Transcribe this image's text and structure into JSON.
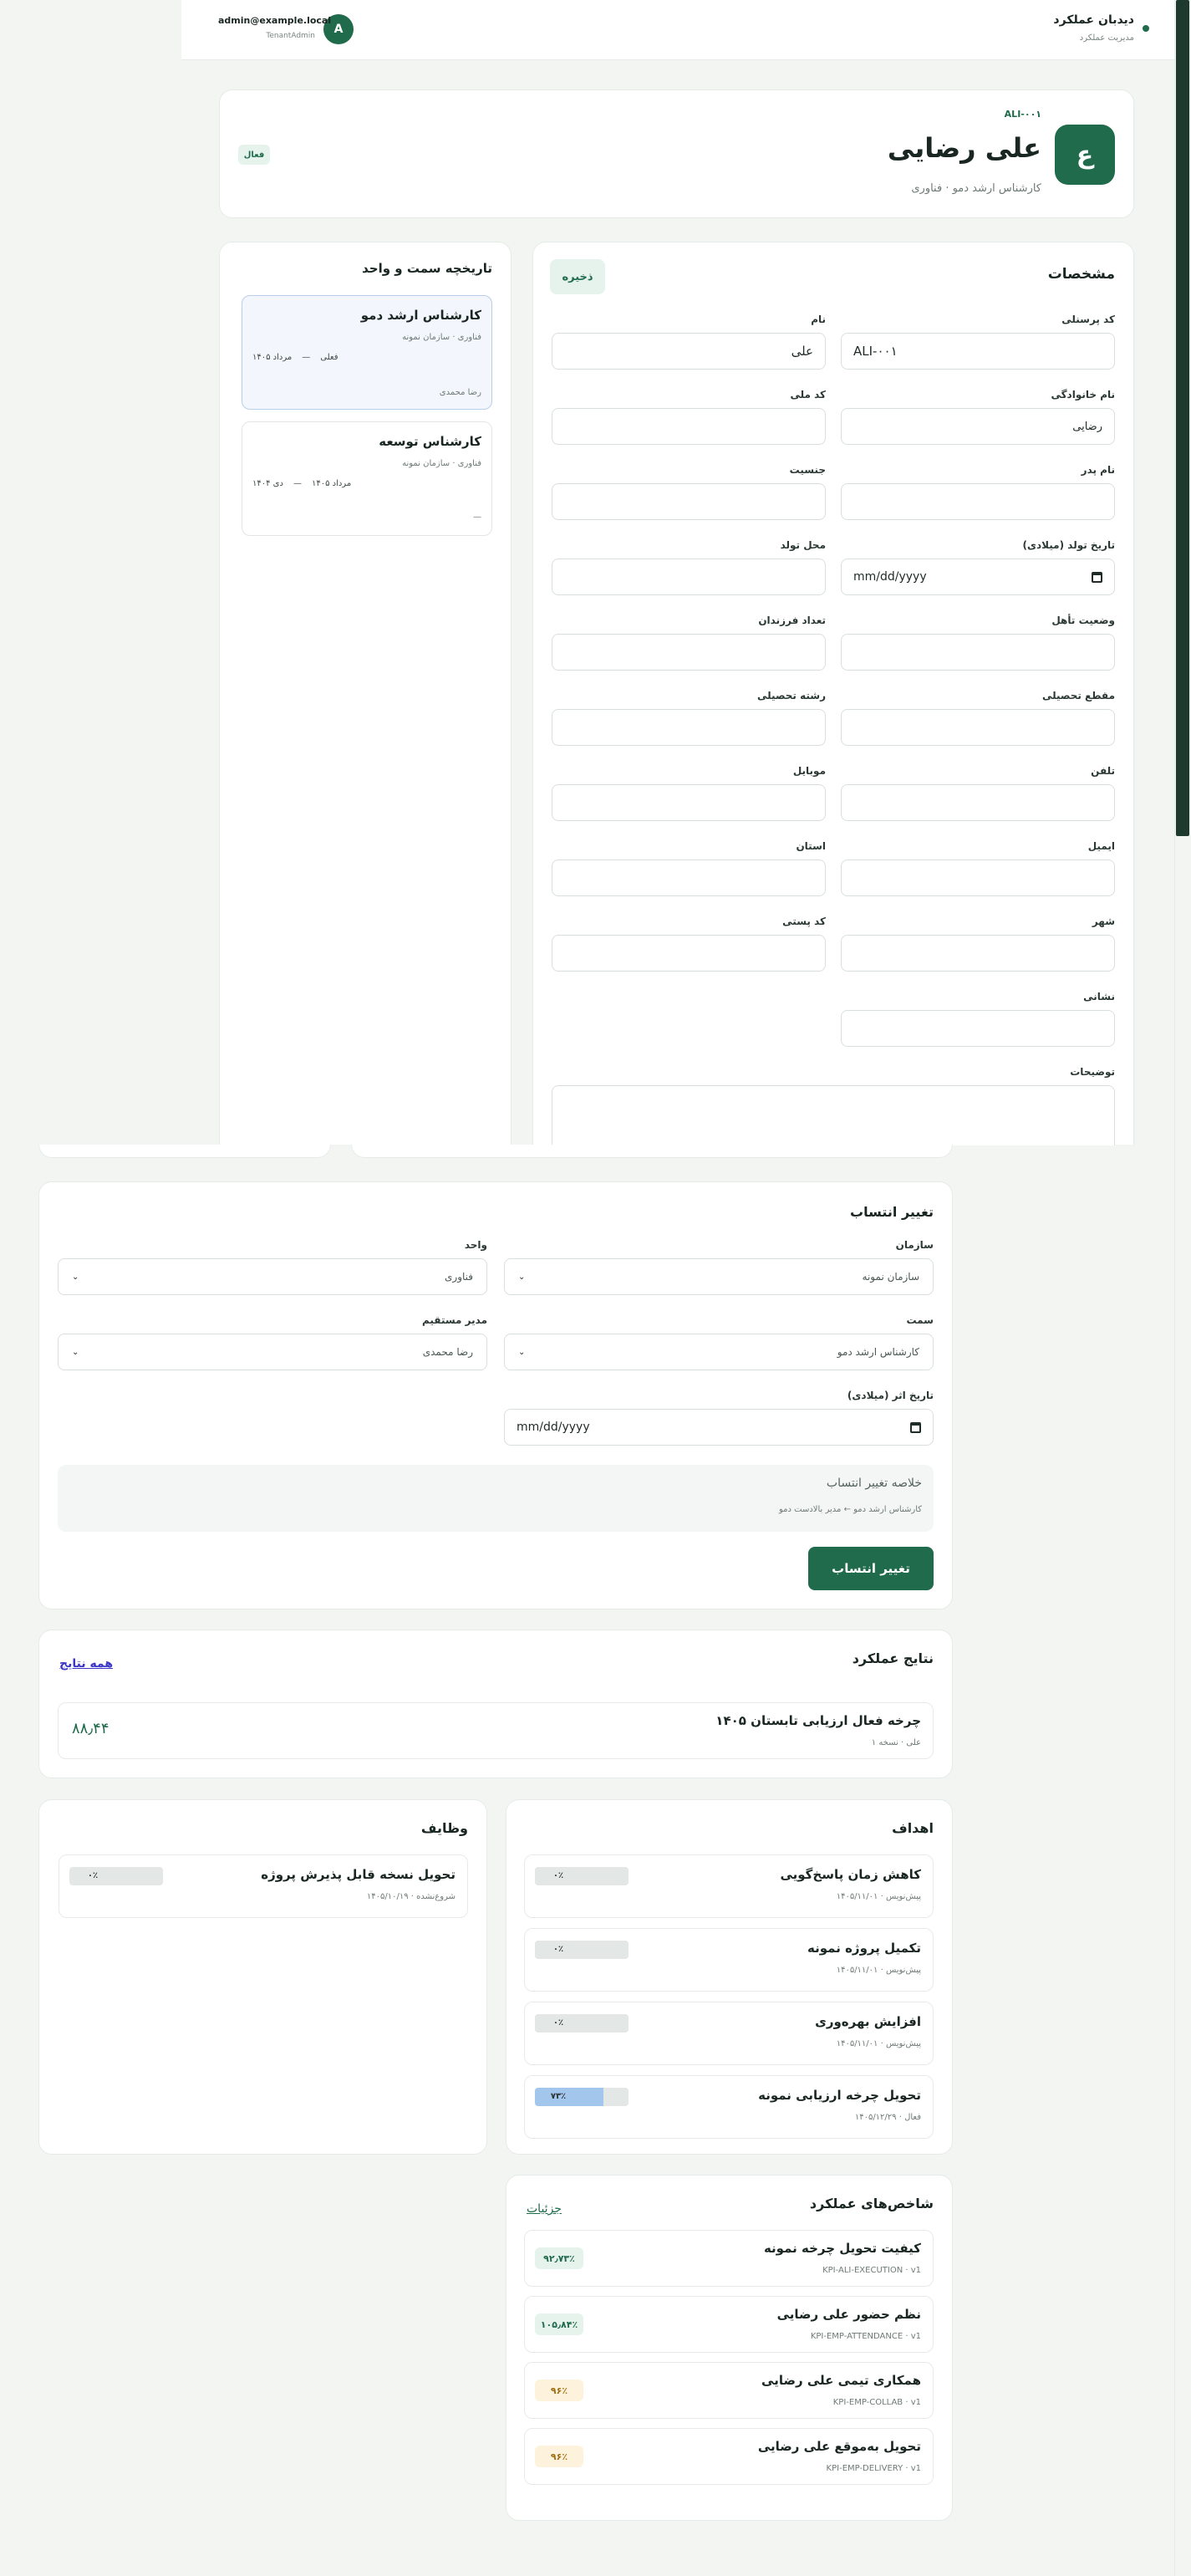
{
  "header": {
    "app_title": "دیدبان عملکرد",
    "app_subtitle": "مدیریت عملکرد",
    "user_email": "admin@example.local",
    "user_role": "TenantAdmin",
    "avatar_letter": "A"
  },
  "profile": {
    "avatar_letter": "ع",
    "code": "ALI-۰۰۱",
    "name": "علی رضایی",
    "subtitle": "کارشناس ارشد دمو · فناوری",
    "status": "فعال"
  },
  "details": {
    "title": "مشخصات",
    "save_label": "ذخیره",
    "fields": [
      {
        "label": "کد پرسنلی",
        "value": ""
      },
      {
        "label": "نام",
        "value": "علی"
      },
      {
        "label": "نام خانوادگی",
        "value": "رضایی"
      },
      {
        "label": "کد ملی",
        "value": ""
      },
      {
        "label": "نام پدر",
        "value": ""
      },
      {
        "label": "جنسیت",
        "value": ""
      },
      {
        "label": "تاریخ تولد (میلادی)",
        "value": "mm/dd/yyyy"
      },
      {
        "label": "محل تولد",
        "value": ""
      },
      {
        "label": "وضعیت تأهل",
        "value": ""
      },
      {
        "label": "تعداد فرزندان",
        "value": ""
      },
      {
        "label": "مقطع تحصیلی",
        "value": ""
      },
      {
        "label": "رشته تحصیلی",
        "value": ""
      },
      {
        "label": "تلفن",
        "value": ""
      },
      {
        "label": "موبایل",
        "value": ""
      },
      {
        "label": "ایمیل",
        "value": ""
      },
      {
        "label": "استان",
        "value": ""
      },
      {
        "label": "شهر",
        "value": ""
      },
      {
        "label": "کد پستی",
        "value": ""
      },
      {
        "label": "نشانی",
        "value": ""
      },
      {
        "label": "توضیحات",
        "value": ""
      }
    ],
    "code_value": "ALI-۰۰۱"
  },
  "history": {
    "title": "تاریخچه سمت و واحد",
    "items": [
      {
        "title": "کارشناس ارشد دمو",
        "org": "فناوری · سازمان نمونه",
        "from": "مرداد ۱۴۰۵",
        "to": "فعلی",
        "manager": "رضا محمدی"
      },
      {
        "title": "کارشناس توسعه",
        "org": "فناوری · سازمان نمونه",
        "from": "دی ۱۴۰۴",
        "to": "مرداد ۱۴۰۵",
        "manager": "—"
      }
    ]
  },
  "assignment": {
    "title": "تغییر انتساب",
    "org_label": "سازمان",
    "org_value": "سازمان نمونه",
    "unit_label": "واحد",
    "unit_value": "فناوری",
    "position_label": "سمت",
    "position_value": "کارشناس ارشد دمو",
    "manager_label": "مدیر مستقیم",
    "manager_value": "رضا محمدی",
    "date_label": "تاریخ اثر (میلادی)",
    "date_value": "mm/dd/yyyy",
    "summary_title": "خلاصه تغییر انتساب",
    "summary_text": "کارشناس ارشد دمو ← مدیر بالادست دمو",
    "submit_label": "تغییر انتساب"
  },
  "results": {
    "title": "نتایج عملکرد",
    "all_link": "همه نتایج",
    "item_title": "چرخه فعال ارزیابی تابستان ۱۴۰۵",
    "item_sub": "علی · نسخه ۱",
    "item_score": "۸۸٫۴۴"
  },
  "goals": {
    "title": "اهداف",
    "items": [
      {
        "title": "کاهش زمان پاسخ‌گویی",
        "meta": "پیش‌نویس · ۱۴۰۵/۱۱/۰۱",
        "progress_label": "۰٪",
        "progress": 0
      },
      {
        "title": "تکمیل پروژه نمونه",
        "meta": "پیش‌نویس · ۱۴۰۵/۱۱/۰۱",
        "progress_label": "۰٪",
        "progress": 0
      },
      {
        "title": "افزایش بهره‌وری",
        "meta": "پیش‌نویس · ۱۴۰۵/۱۱/۰۱",
        "progress_label": "۰٪",
        "progress": 0
      },
      {
        "title": "تحویل چرخه ارزیابی نمونه",
        "meta": "فعال · ۱۴۰۵/۱۲/۲۹",
        "progress_label": "۷۳٪",
        "progress": 73
      }
    ]
  },
  "tasks": {
    "title": "وظایف",
    "items": [
      {
        "title": "تحویل نسخه قابل پذیرش پروژه",
        "meta": "شروع‌نشده · ۱۴۰۵/۱۰/۱۹",
        "progress_label": "۰٪"
      }
    ]
  },
  "kpis": {
    "title": "شاخص‌های عملکرد",
    "details_link": "جزئیات",
    "items": [
      {
        "title": "کیفیت تحویل چرخه نمونه",
        "code": "KPI-ALI-EXECUTION · v1",
        "value": "۹۲٫۷۳٪",
        "tone": "green"
      },
      {
        "title": "نظم حضور علی رضایی",
        "code": "KPI-EMP-ATTENDANCE · v1",
        "value": "۱۰۵٫۸۴٪",
        "tone": "green"
      },
      {
        "title": "همکاری تیمی علی رضایی",
        "code": "KPI-EMP-COLLAB · v1",
        "value": "۹۶٪",
        "tone": "yellow"
      },
      {
        "title": "تحویل به‌موقع علی رضایی",
        "code": "KPI-EMP-DELIVERY · v1",
        "value": "۹۶٪",
        "tone": "yellow"
      }
    ]
  },
  "colors": {
    "brand": "#1f6b4b",
    "green_chip_bg": "#e6f3ec",
    "yellow_chip_bg": "#fdf3dc",
    "progress_fill": "#a3c6ec"
  }
}
